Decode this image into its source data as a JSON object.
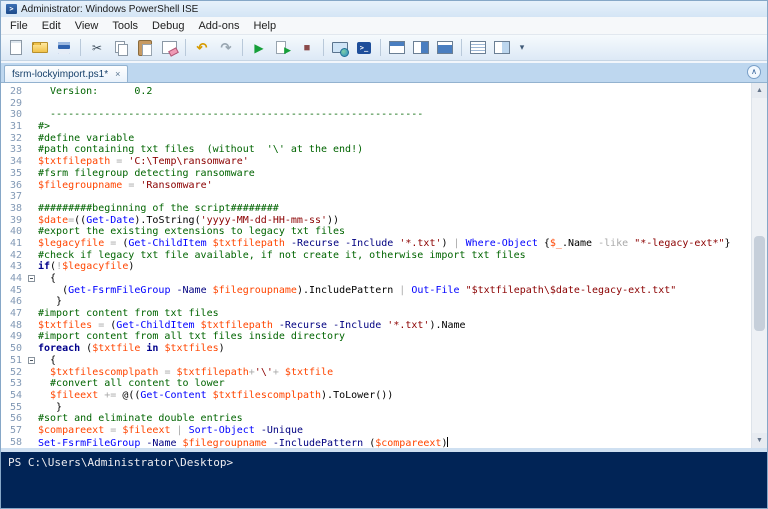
{
  "window": {
    "title": "Administrator: Windows PowerShell ISE"
  },
  "menu": {
    "items": [
      "File",
      "Edit",
      "View",
      "Tools",
      "Debug",
      "Add-ons",
      "Help"
    ]
  },
  "toolbar": {
    "buttons": [
      {
        "name": "new-script"
      },
      {
        "name": "open-script"
      },
      {
        "name": "save-script"
      },
      {
        "sep": true
      },
      {
        "name": "cut",
        "glyph": "✂"
      },
      {
        "name": "copy"
      },
      {
        "name": "paste"
      },
      {
        "name": "clear-console"
      },
      {
        "sep": true
      },
      {
        "name": "undo",
        "glyph": "↶"
      },
      {
        "name": "redo",
        "glyph": "↷"
      },
      {
        "sep": true
      },
      {
        "name": "run-script",
        "glyph": "▶"
      },
      {
        "name": "run-selection",
        "glyph": "▶"
      },
      {
        "name": "stop-operation",
        "glyph": "■"
      },
      {
        "sep": true
      },
      {
        "name": "new-remote-tab"
      },
      {
        "name": "start-powershell"
      },
      {
        "sep": true
      },
      {
        "name": "pane-top"
      },
      {
        "name": "pane-right"
      },
      {
        "name": "pane-max"
      },
      {
        "sep": true
      },
      {
        "name": "command-window"
      },
      {
        "name": "command-addon"
      },
      {
        "name": "overflow",
        "glyph": "▾"
      }
    ]
  },
  "tab": {
    "label": "fsrm-lockyimport.ps1*",
    "close_glyph": "×",
    "collapse_glyph": "∧"
  },
  "scrollbar": {
    "up_glyph": "▲",
    "down_glyph": "▼"
  },
  "colors": {
    "comment": "#006400",
    "variable": "#FF4500",
    "string": "#8B0000",
    "command": "#0000FF",
    "parameter": "#000080",
    "keyword": "#00008B",
    "operator": "#A9A9A9",
    "text": "#000000",
    "console_bg": "#012456",
    "console_fg": "#EEEDF0"
  },
  "editor": {
    "lines": [
      {
        "n": 28,
        "tokens": [
          [
            "c",
            "  Version:      0.2"
          ]
        ]
      },
      {
        "n": 29,
        "tokens": []
      },
      {
        "n": 30,
        "tokens": [
          [
            "c",
            "  --------------------------------------------------------------"
          ]
        ]
      },
      {
        "n": 31,
        "tokens": [
          [
            "c",
            "#>"
          ]
        ]
      },
      {
        "n": 32,
        "tokens": [
          [
            "c",
            "#define variable"
          ]
        ]
      },
      {
        "n": 33,
        "tokens": [
          [
            "c",
            "#path containing txt files  (without  '\\' at the end!)"
          ]
        ]
      },
      {
        "n": 34,
        "tokens": [
          [
            "v",
            "$txtfilepath"
          ],
          [
            "t",
            " "
          ],
          [
            "o",
            "="
          ],
          [
            "t",
            " "
          ],
          [
            "s",
            "'C:\\Temp\\ransomware'"
          ]
        ]
      },
      {
        "n": 35,
        "tokens": [
          [
            "c",
            "#fsrm filegroup detecting ransomware"
          ]
        ]
      },
      {
        "n": 36,
        "tokens": [
          [
            "v",
            "$filegroupname"
          ],
          [
            "t",
            " "
          ],
          [
            "o",
            "="
          ],
          [
            "t",
            " "
          ],
          [
            "s",
            "'Ransomware'"
          ]
        ]
      },
      {
        "n": 37,
        "tokens": []
      },
      {
        "n": 38,
        "tokens": [
          [
            "c",
            "#########beginning of the script########"
          ]
        ]
      },
      {
        "n": 39,
        "tokens": [
          [
            "v",
            "$date"
          ],
          [
            "o",
            "="
          ],
          [
            "t",
            "(("
          ],
          [
            "m",
            "Get-Date"
          ],
          [
            "t",
            ").ToString("
          ],
          [
            "s",
            "'yyyy-MM-dd-HH-mm-ss'"
          ],
          [
            "t",
            "))"
          ]
        ]
      },
      {
        "n": 40,
        "tokens": [
          [
            "c",
            "#export the existing extensions to legacy txt files"
          ]
        ]
      },
      {
        "n": 41,
        "tokens": [
          [
            "v",
            "$legacyfile"
          ],
          [
            "t",
            " "
          ],
          [
            "o",
            "="
          ],
          [
            "t",
            " ("
          ],
          [
            "m",
            "Get-ChildItem"
          ],
          [
            "t",
            " "
          ],
          [
            "v",
            "$txtfilepath"
          ],
          [
            "t",
            " "
          ],
          [
            "p",
            "-Recurse"
          ],
          [
            "t",
            " "
          ],
          [
            "p",
            "-Include"
          ],
          [
            "t",
            " "
          ],
          [
            "s",
            "'*.txt'"
          ],
          [
            "t",
            ") "
          ],
          [
            "o",
            "|"
          ],
          [
            "t",
            " "
          ],
          [
            "m",
            "Where-Object"
          ],
          [
            "t",
            " {"
          ],
          [
            "v",
            "$_"
          ],
          [
            "t",
            ".Name "
          ],
          [
            "o",
            "-like"
          ],
          [
            "t",
            " "
          ],
          [
            "s",
            "\"*-legacy-ext*\""
          ],
          [
            "t",
            "}"
          ]
        ]
      },
      {
        "n": 42,
        "tokens": [
          [
            "c",
            "#check if legacy txt file available, if not create it, otherwise import txt files"
          ]
        ]
      },
      {
        "n": 43,
        "tokens": [
          [
            "k",
            "if"
          ],
          [
            "t",
            "("
          ],
          [
            "o",
            "!"
          ],
          [
            "v",
            "$legacyfile"
          ],
          [
            "t",
            ")"
          ]
        ]
      },
      {
        "n": 44,
        "fold": true,
        "tokens": [
          [
            "t",
            "  {"
          ]
        ]
      },
      {
        "n": 45,
        "tokens": [
          [
            "t",
            "    ("
          ],
          [
            "m",
            "Get-FsrmFileGroup"
          ],
          [
            "t",
            " "
          ],
          [
            "p",
            "-Name"
          ],
          [
            "t",
            " "
          ],
          [
            "v",
            "$filegroupname"
          ],
          [
            "t",
            ").IncludePattern "
          ],
          [
            "o",
            "|"
          ],
          [
            "t",
            " "
          ],
          [
            "m",
            "Out-File"
          ],
          [
            "t",
            " "
          ],
          [
            "s",
            "\"$txtfilepath\\$date-legacy-ext.txt\""
          ]
        ]
      },
      {
        "n": 46,
        "tokens": [
          [
            "t",
            "   }"
          ]
        ]
      },
      {
        "n": 47,
        "tokens": [
          [
            "c",
            "#import content from txt files"
          ]
        ]
      },
      {
        "n": 48,
        "tokens": [
          [
            "v",
            "$txtfiles"
          ],
          [
            "t",
            " "
          ],
          [
            "o",
            "="
          ],
          [
            "t",
            " ("
          ],
          [
            "m",
            "Get-ChildItem"
          ],
          [
            "t",
            " "
          ],
          [
            "v",
            "$txtfilepath"
          ],
          [
            "t",
            " "
          ],
          [
            "p",
            "-Recurse"
          ],
          [
            "t",
            " "
          ],
          [
            "p",
            "-Include"
          ],
          [
            "t",
            " "
          ],
          [
            "s",
            "'*.txt'"
          ],
          [
            "t",
            ").Name"
          ]
        ]
      },
      {
        "n": 49,
        "tokens": [
          [
            "c",
            "#import content from all txt files inside directory"
          ]
        ]
      },
      {
        "n": 50,
        "tokens": [
          [
            "k",
            "foreach"
          ],
          [
            "t",
            " ("
          ],
          [
            "v",
            "$txtfile"
          ],
          [
            "t",
            " "
          ],
          [
            "k",
            "in"
          ],
          [
            "t",
            " "
          ],
          [
            "v",
            "$txtfiles"
          ],
          [
            "t",
            ")"
          ]
        ]
      },
      {
        "n": 51,
        "fold": true,
        "tokens": [
          [
            "t",
            "  {"
          ]
        ]
      },
      {
        "n": 52,
        "tokens": [
          [
            "t",
            "  "
          ],
          [
            "v",
            "$txtfilescomplpath"
          ],
          [
            "t",
            " "
          ],
          [
            "o",
            "="
          ],
          [
            "t",
            " "
          ],
          [
            "v",
            "$txtfilepath"
          ],
          [
            "o",
            "+"
          ],
          [
            "s",
            "'\\'"
          ],
          [
            "o",
            "+"
          ],
          [
            "t",
            " "
          ],
          [
            "v",
            "$txtfile"
          ]
        ]
      },
      {
        "n": 53,
        "tokens": [
          [
            "c",
            "  #convert all content to lower"
          ]
        ]
      },
      {
        "n": 54,
        "tokens": [
          [
            "t",
            "  "
          ],
          [
            "v",
            "$fileext"
          ],
          [
            "t",
            " "
          ],
          [
            "o",
            "+="
          ],
          [
            "t",
            " @(("
          ],
          [
            "m",
            "Get-Content"
          ],
          [
            "t",
            " "
          ],
          [
            "v",
            "$txtfilescomplpath"
          ],
          [
            "t",
            ").ToLower())"
          ]
        ]
      },
      {
        "n": 55,
        "tokens": [
          [
            "t",
            "   }"
          ]
        ]
      },
      {
        "n": 56,
        "tokens": [
          [
            "c",
            "#sort and eliminate double entries"
          ]
        ]
      },
      {
        "n": 57,
        "tokens": [
          [
            "v",
            "$compareext"
          ],
          [
            "t",
            " "
          ],
          [
            "o",
            "="
          ],
          [
            "t",
            " "
          ],
          [
            "v",
            "$fileext"
          ],
          [
            "t",
            " "
          ],
          [
            "o",
            "|"
          ],
          [
            "t",
            " "
          ],
          [
            "m",
            "Sort-Object"
          ],
          [
            "t",
            " "
          ],
          [
            "p",
            "-Unique"
          ]
        ]
      },
      {
        "n": 58,
        "caret": true,
        "tokens": [
          [
            "m",
            "Set-FsrmFileGroup"
          ],
          [
            "t",
            " "
          ],
          [
            "p",
            "-Name"
          ],
          [
            "t",
            " "
          ],
          [
            "v",
            "$filegroupname"
          ],
          [
            "t",
            " "
          ],
          [
            "p",
            "-IncludePattern"
          ],
          [
            "t",
            " ("
          ],
          [
            "v",
            "$compareext"
          ],
          [
            "t",
            ")"
          ]
        ]
      }
    ]
  },
  "console": {
    "prompt": "PS C:\\Users\\Administrator\\Desktop>"
  }
}
